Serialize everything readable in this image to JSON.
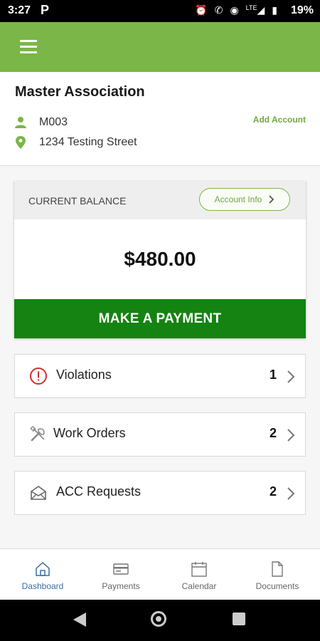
{
  "status_bar": {
    "time": "3:27",
    "app_indicator": "P",
    "icons": [
      "alarm-icon",
      "volte-icon",
      "hotspot-icon",
      "lte-signal-icon",
      "battery-icon"
    ],
    "lte_label": "LTE",
    "battery": "19%"
  },
  "header": {
    "menu_icon": "hamburger-icon",
    "color": "#7ab648"
  },
  "association": {
    "name": "Master Association",
    "account_id": "M003",
    "address": "1234 Testing Street",
    "add_account": "Add Account"
  },
  "balance": {
    "label": "CURRENT BALANCE",
    "account_info": "Account Info",
    "amount": "$480.00",
    "pay_button": "MAKE A PAYMENT"
  },
  "items": [
    {
      "label": "Violations",
      "count": "1",
      "icon": "alert-circle-icon"
    },
    {
      "label": "Work Orders",
      "count": "2",
      "icon": "tools-icon"
    },
    {
      "label": "ACC Requests",
      "count": "2",
      "icon": "envelope-open-icon"
    }
  ],
  "bottom_nav": [
    {
      "label": "Dashboard",
      "icon": "home-icon",
      "active": true
    },
    {
      "label": "Payments",
      "icon": "credit-card-icon",
      "active": false
    },
    {
      "label": "Calendar",
      "icon": "calendar-icon",
      "active": false
    },
    {
      "label": "Documents",
      "icon": "document-icon",
      "active": false
    }
  ],
  "colors": {
    "accent": "#7ab648",
    "pay": "#148312",
    "alert": "#d32f2f",
    "active_nav": "#3a6ea5"
  }
}
